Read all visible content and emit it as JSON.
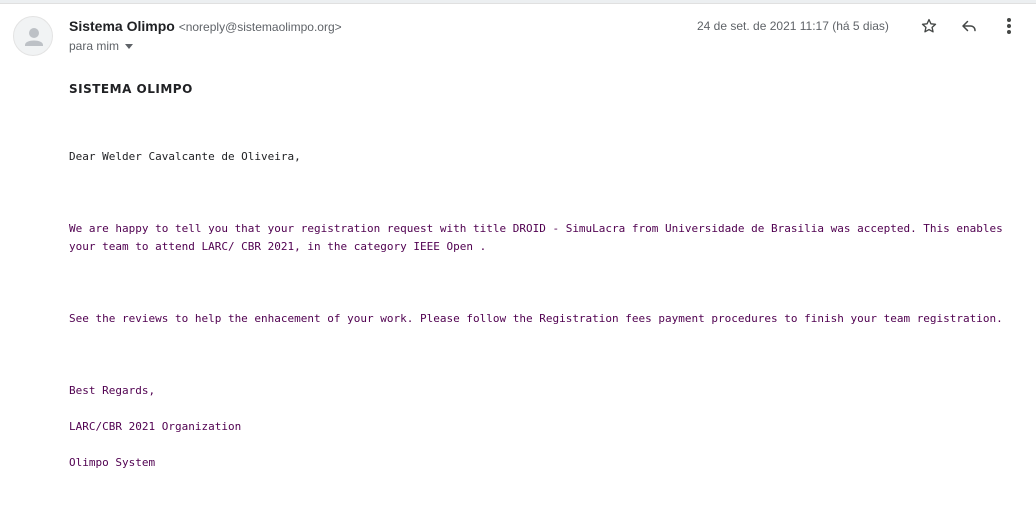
{
  "sender": {
    "name": "Sistema Olimpo",
    "email": "<noreply@sistemaolimpo.org>",
    "recipient": "para mim"
  },
  "date": "24 de set. de 2021 11:17 (há 5 dias)",
  "icons": {
    "star": "star-icon",
    "reply": "reply-icon",
    "more": "more-vert-icon",
    "avatar": "person-icon"
  },
  "message": {
    "org_title": "SISTEMA OLIMPO",
    "greeting": "Dear Welder Cavalcante de Oliveira,",
    "paragraph1": "We are happy to tell you that your registration request with title DROID - SimuLacra from Universidade de Brasilia was accepted. This enables your team to attend LARC/ CBR 2021, in the category IEEE Open .",
    "paragraph2": "See the reviews to help the enhacement of your work. Please follow the Registration fees payment procedures to finish your team registration.",
    "closing": "Best Regards,",
    "signature_org": "LARC/CBR 2021 Organization",
    "signature_system": "Olimpo System"
  },
  "colors": {
    "quoted_text": "#500050",
    "primary_text": "#202124",
    "secondary_text": "#5f6368"
  }
}
